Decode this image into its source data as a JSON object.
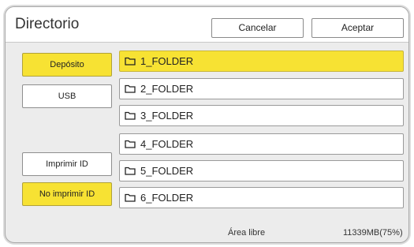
{
  "header": {
    "title": "Directorio",
    "cancel_label": "Cancelar",
    "accept_label": "Aceptar"
  },
  "sidebar": {
    "items": [
      {
        "label": "Depósito",
        "selected": true
      },
      {
        "label": "USB",
        "selected": false
      },
      {
        "label": "Imprimir ID",
        "selected": false
      },
      {
        "label": "No imprimir ID",
        "selected": true
      }
    ]
  },
  "folders": {
    "icon": "folder-icon",
    "items": [
      {
        "label": "1_FOLDER",
        "selected": true
      },
      {
        "label": "2_FOLDER",
        "selected": false
      },
      {
        "label": "3_FOLDER",
        "selected": false
      },
      {
        "label": "4_FOLDER",
        "selected": false
      },
      {
        "label": "5_FOLDER",
        "selected": false
      },
      {
        "label": "6_FOLDER",
        "selected": false
      }
    ]
  },
  "footer": {
    "free_area_label": "Área libre",
    "free_area_value": "11339MB(75%)"
  },
  "colors": {
    "selected": "#f7e233",
    "background": "#ececec"
  }
}
